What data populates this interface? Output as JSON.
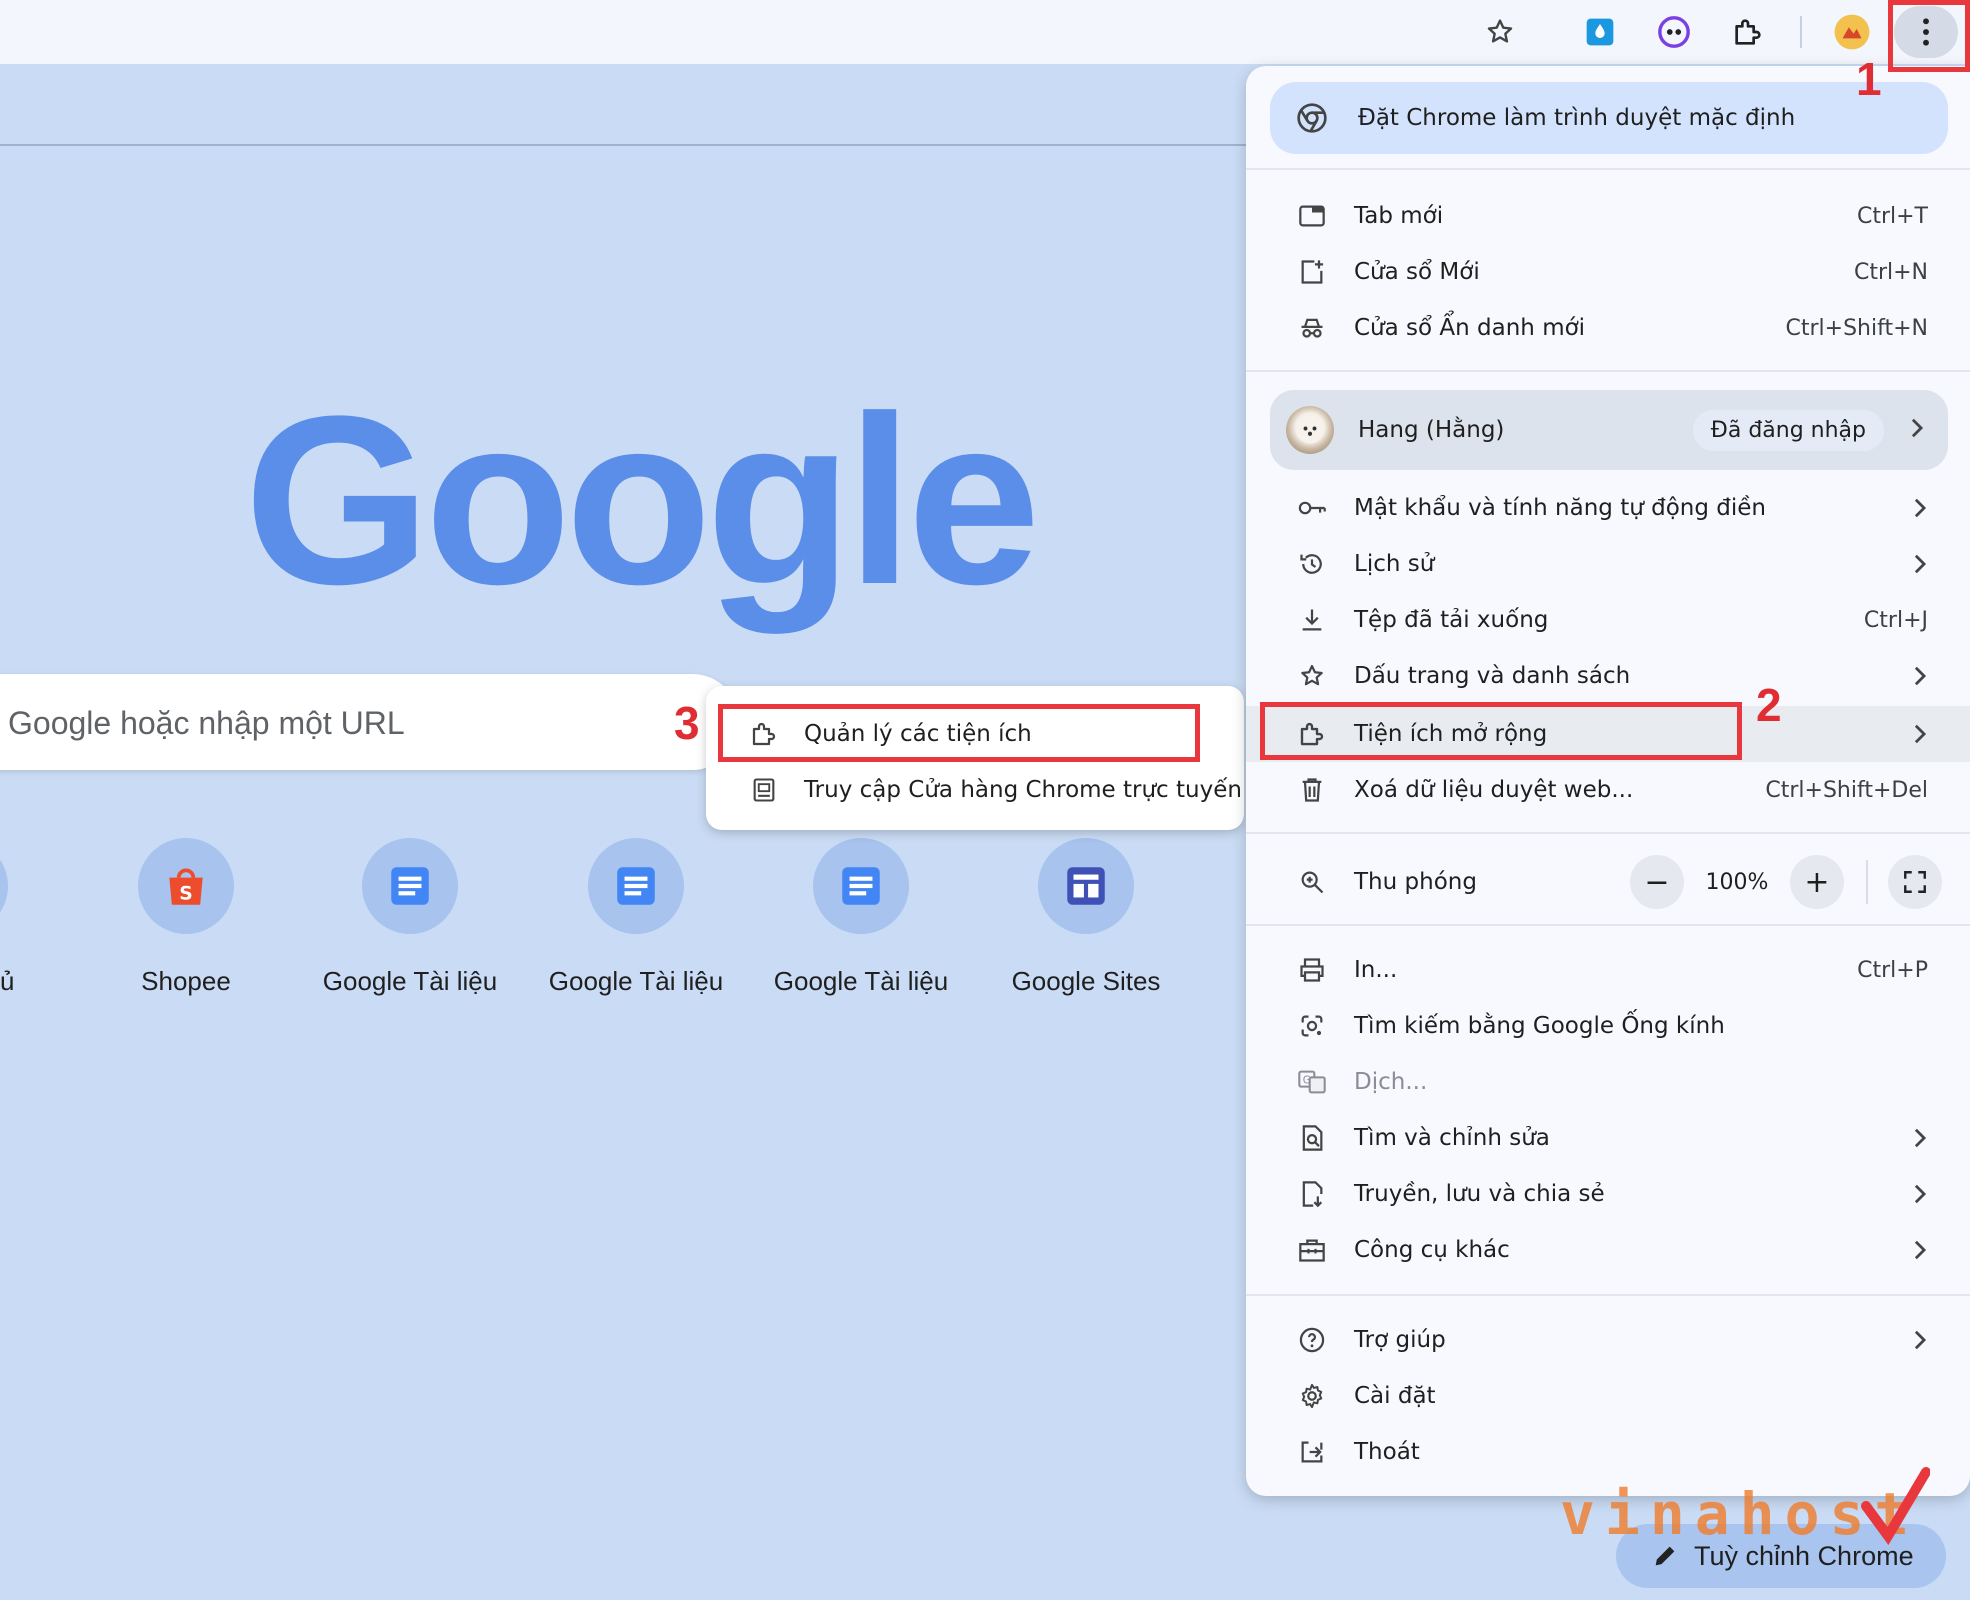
{
  "toolbar": {
    "icons": [
      "bookmark-star-icon",
      "extension-drop-icon",
      "extension-eyes-icon",
      "extensions-puzzle-icon",
      "profile-avatar-icon",
      "more-menu-icon"
    ]
  },
  "ntp": {
    "logo_text": "Google",
    "search": {
      "placeholder": "Google hoặc nhập một URL"
    },
    "partial_shortcut_label": "ủ",
    "shortcuts": [
      {
        "label": "Shopee",
        "icon": "shopee-bag-icon",
        "color": "#ee4d2d"
      },
      {
        "label": "Google Tài liệu",
        "icon": "google-docs-icon",
        "color": "#4285f4"
      },
      {
        "label": "Google Tài liệu",
        "icon": "google-docs-icon",
        "color": "#4285f4"
      },
      {
        "label": "Google Tài liệu",
        "icon": "google-docs-icon",
        "color": "#4285f4"
      },
      {
        "label": "Google Sites",
        "icon": "google-sites-icon",
        "color": "#3f51b5"
      }
    ],
    "customize_label": "Tuỳ chỉnh Chrome"
  },
  "submenu": {
    "items": [
      {
        "label": "Quản lý các tiện ích",
        "icon": "puzzle-icon"
      },
      {
        "label": "Truy cập Cửa hàng Chrome trực tuyến",
        "icon": "web-store-icon"
      }
    ]
  },
  "menu": {
    "default_banner": "Đặt Chrome làm trình duyệt mặc định",
    "group1": [
      {
        "label": "Tab mới",
        "shortcut": "Ctrl+T",
        "icon": "new-tab-icon"
      },
      {
        "label": "Cửa sổ Mới",
        "shortcut": "Ctrl+N",
        "icon": "new-window-icon"
      },
      {
        "label": "Cửa sổ Ẩn danh mới",
        "shortcut": "Ctrl+Shift+N",
        "icon": "incognito-icon"
      }
    ],
    "profile": {
      "name": "Hang (Hằng)",
      "status": "Đã đăng nhập"
    },
    "group2": [
      {
        "label": "Mật khẩu và tính năng tự động điền",
        "shortcut": "",
        "icon": "key-icon"
      },
      {
        "label": "Lịch sử",
        "shortcut": "",
        "icon": "history-icon"
      },
      {
        "label": "Tệp đã tải xuống",
        "shortcut": "Ctrl+J",
        "icon": "download-icon"
      },
      {
        "label": "Dấu trang và danh sách",
        "shortcut": "",
        "icon": "star-icon"
      },
      {
        "label": "Tiện ích mở rộng",
        "shortcut": "",
        "icon": "puzzle-icon"
      },
      {
        "label": "Xoá dữ liệu duyệt web...",
        "shortcut": "Ctrl+Shift+Del",
        "icon": "trash-icon"
      }
    ],
    "zoom": {
      "label": "Thu phóng",
      "minus": "−",
      "value": "100%",
      "plus": "+"
    },
    "group3": [
      {
        "label": "In...",
        "shortcut": "Ctrl+P",
        "icon": "print-icon"
      },
      {
        "label": "Tìm kiếm bằng Google Ống kính",
        "shortcut": "",
        "icon": "lens-icon"
      },
      {
        "label": "Dịch...",
        "shortcut": "",
        "icon": "translate-icon"
      },
      {
        "label": "Tìm và chỉnh sửa",
        "shortcut": "",
        "icon": "find-icon"
      },
      {
        "label": "Truyền, lưu và chia sẻ",
        "shortcut": "",
        "icon": "cast-save-icon"
      },
      {
        "label": "Công cụ khác",
        "shortcut": "",
        "icon": "toolbox-icon"
      }
    ],
    "group4": [
      {
        "label": "Trợ giúp",
        "icon": "help-icon"
      },
      {
        "label": "Cài đặt",
        "icon": "gear-icon"
      },
      {
        "label": "Thoát",
        "icon": "exit-icon"
      }
    ]
  },
  "annotations": {
    "step1": "1",
    "step2": "2",
    "step3": "3",
    "highlight_color": "#e8383d"
  },
  "watermark": "vinahost"
}
